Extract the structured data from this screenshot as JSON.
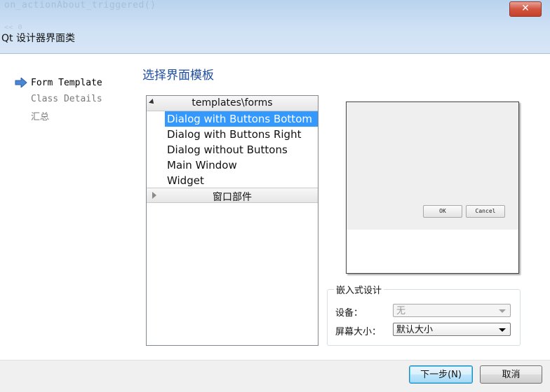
{
  "window": {
    "title": "Qt 设计器界面类",
    "background_code": [
      "on_actionAbout_triggered()",
      "",
      "<< 0"
    ],
    "close_glyph": "✕"
  },
  "steps": [
    {
      "label": "Form Template",
      "active": true
    },
    {
      "label": "Class Details",
      "active": false
    },
    {
      "label": "汇总",
      "active": false
    }
  ],
  "page": {
    "title": "选择界面模板"
  },
  "templates": {
    "group1": {
      "label": "templates\\forms",
      "expanded": true,
      "items": [
        "Dialog with Buttons Bottom",
        "Dialog with Buttons Right",
        "Dialog without Buttons",
        "Main Window",
        "Widget"
      ],
      "selected_index": 0
    },
    "group2": {
      "label": "窗口部件",
      "expanded": false
    }
  },
  "preview": {
    "ok_label": "OK",
    "cancel_label": "Cancel"
  },
  "embedded": {
    "title": "嵌入式设计",
    "device_label": "设备：",
    "device_value": "无",
    "screen_label": "屏幕大小：",
    "screen_value": "默认大小"
  },
  "footer": {
    "next_label": "下一步(N)",
    "cancel_label": "取消"
  },
  "colors": {
    "accent": "#3399ff",
    "title_text": "#1f4ea3",
    "close_red": "#c8402a"
  }
}
